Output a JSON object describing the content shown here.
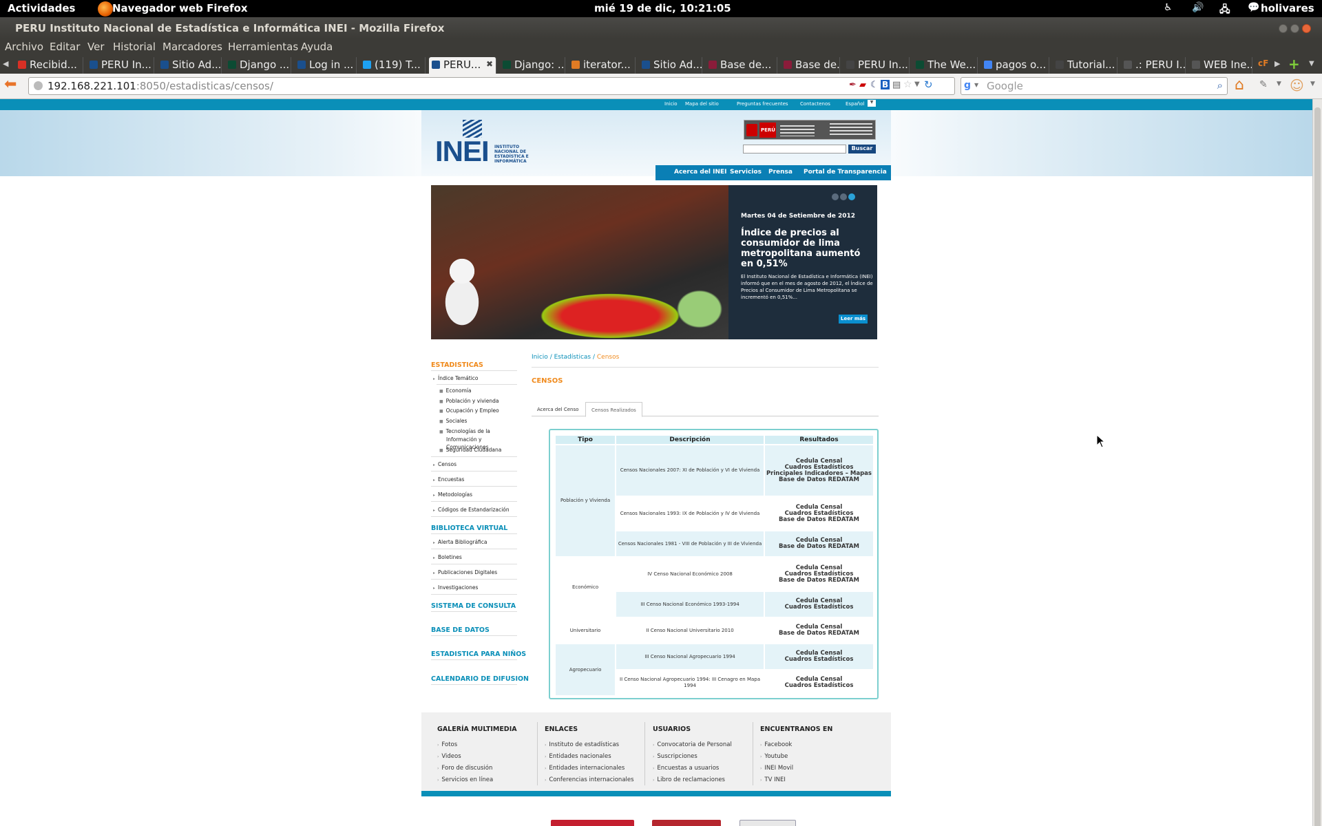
{
  "desktop": {
    "activities": "Actividades",
    "app_name": "Navegador web Firefox",
    "clock": "mié 19 de dic, 10:21:05",
    "user": "holivares"
  },
  "window": {
    "title": "PERU Instituto Nacional de Estadística e Informática INEI - Mozilla Firefox"
  },
  "menu": [
    "Archivo",
    "Editar",
    "Ver",
    "Historial",
    "Marcadores",
    "Herramientas",
    "Ayuda"
  ],
  "tabs": [
    {
      "label": "Recibid...",
      "icon": "gmail-icon",
      "color": "#d93025"
    },
    {
      "label": "PERU In...",
      "icon": "inei-icon",
      "color": "#1a4f8d"
    },
    {
      "label": "Sitio Ad...",
      "icon": "inei-icon",
      "color": "#1a4f8d"
    },
    {
      "label": "Django ...",
      "icon": "django-icon",
      "color": "#0c4b33"
    },
    {
      "label": "Log in ...",
      "icon": "page-icon",
      "color": "#1a4f8d"
    },
    {
      "label": "(119) T...",
      "icon": "twitter-icon",
      "color": "#1da1f2"
    },
    {
      "label": "PERU...",
      "icon": "inei-icon",
      "color": "#1a4f8d",
      "active": true
    },
    {
      "label": "Django: ...",
      "icon": "django-icon",
      "color": "#0c4b33"
    },
    {
      "label": "iterator...",
      "icon": "page-icon",
      "color": "#e07b24"
    },
    {
      "label": "Sitio Ad...",
      "icon": "inei-icon",
      "color": "#1a4f8d"
    },
    {
      "label": "Base de...",
      "icon": "flag-icon",
      "color": "#8a1c3a"
    },
    {
      "label": "Base de...",
      "icon": "flag-icon",
      "color": "#8a1c3a"
    },
    {
      "label": "PERU In...",
      "icon": "page-icon",
      "color": "#444"
    },
    {
      "label": "The We...",
      "icon": "django-icon",
      "color": "#0c4b33"
    },
    {
      "label": "pagos o...",
      "icon": "google-icon",
      "color": "#4285f4"
    },
    {
      "label": "Tutorial...",
      "icon": "page-icon",
      "color": "#444"
    },
    {
      "label": ".: PERU I...",
      "icon": "page-icon",
      "color": "#555"
    },
    {
      "label": "WEB Ine...",
      "icon": "page-icon",
      "color": "#555"
    }
  ],
  "navbar": {
    "url_host": "192.168.221.101",
    "url_rest": ":8050/estadisticas/censos/",
    "search_placeholder": "Google"
  },
  "site": {
    "top_links": [
      "Inicio",
      "Mapa del sitio",
      "Preguntas frecuentes",
      "Contactenos",
      "Español"
    ],
    "logo": "INEI",
    "logo_sub": "INSTITUTO NACIONAL DE ESTADÍSTICA E INFORMÁTICA",
    "search_button": "Buscar",
    "main_nav": [
      "Acerca del INEI",
      "Servicios",
      "Prensa",
      "Portal de Transparencia"
    ],
    "hero": {
      "date": "Martes 04 de Setiembre de 2012",
      "title": "Índice de precios al consumidor de lima metropolitana aumentó en 0,51%",
      "text": "El Instituto Nacional de Estadística e Informática (INEI) informó que en el mes de agosto de 2012, el Índice de Precios al Consumidor de Lima Metropolitana se incrementó en 0,51%...",
      "more": "Leer más"
    },
    "sidebar": {
      "estadisticas": "ESTADISTICAS",
      "indice": "Índice Temático",
      "sub": [
        "Economía",
        "Población y vivienda",
        "Ocupación y Empleo",
        "Sociales",
        "Tecnologías de la Información y Comunicaciones",
        "Seguridad Ciudadana"
      ],
      "items": [
        "Censos",
        "Encuestas",
        "Metodologías",
        "Códigos de Estandarización"
      ],
      "biblioteca": "BIBLIOTECA VIRTUAL",
      "bib_items": [
        "Alerta Bibliográfica",
        "Boletines",
        "Publicaciones Digitales",
        "Investigaciones"
      ],
      "sistema": "SISTEMA DE CONSULTA",
      "base": "BASE DE DATOS",
      "ninos": "ESTADISTICA PARA NIÑOS",
      "calendario": "CALENDARIO DE DIFUSION"
    },
    "breadcrumb": {
      "home": "Inicio",
      "sep": " / ",
      "section": "Estadísticas",
      "current": "Censos"
    },
    "page_title": "CENSOS",
    "page_tabs": [
      "Acerca del Censo",
      "Censos Realizados"
    ],
    "table": {
      "headers": [
        "Tipo",
        "Descripción",
        "Resultados"
      ],
      "types": [
        "Población y Vivienda",
        "Económico",
        "Universitario",
        "Agropecuario"
      ],
      "rows": [
        {
          "desc": "Censos Nacionales 2007: XI de Población y VI de Vivienda",
          "res": [
            "Cedula Censal",
            "Cuadros Estadísticos",
            "Principales Indicadores – Mapas",
            "Base de Datos REDATAM"
          ]
        },
        {
          "desc": "Censos Nacionales 1993: IX de Población y IV de Vivienda",
          "res": [
            "Cedula Censal",
            "Cuadros Estadísticos",
            "Base de Datos REDATAM"
          ]
        },
        {
          "desc": "Censos Nacionales 1981 - VIII de Población y III de Vivienda",
          "res": [
            "Cedula Censal",
            "Base de Datos REDATAM"
          ]
        },
        {
          "desc": "IV Censo Nacional Económico 2008",
          "res": [
            "Cedula Censal",
            "Cuadros Estadísticos",
            "Base de Datos REDATAM"
          ]
        },
        {
          "desc": "III Censo Nacional Económico 1993-1994",
          "res": [
            "Cedula Censal",
            "Cuadros Estadísticos"
          ]
        },
        {
          "desc": "II Censo Nacional Universitario 2010",
          "res": [
            "Cedula Censal",
            "Base de Datos REDATAM"
          ]
        },
        {
          "desc": "III Censo Nacional Agropecuario 1994",
          "res": [
            "Cedula Censal",
            "Cuadros Estadísticos"
          ]
        },
        {
          "desc": "II Censo Nacional Agropecuario 1994: III Cenagro en Mapa 1994",
          "res": [
            "Cedula Censal",
            "Cuadros Estadísticos"
          ]
        }
      ]
    },
    "footer": [
      {
        "title": "GALERÍA MULTIMEDIA",
        "items": [
          "Fotos",
          "Videos",
          "Foro de discusión",
          "Servicios en línea"
        ]
      },
      {
        "title": "ENLACES",
        "items": [
          "Instituto de estadísticas",
          "Entidades nacionales",
          "Entidades internacionales",
          "Conferencias internacionales"
        ]
      },
      {
        "title": "USUARIOS",
        "items": [
          "Convocatoria de Personal",
          "Suscripciones",
          "Encuestas a usuarios",
          "Libro de reclamaciones"
        ]
      },
      {
        "title": "ENCUENTRANOS EN",
        "items": [
          "Facebook",
          "Youtube",
          "INEI Movil",
          "TV INEI"
        ]
      }
    ]
  }
}
